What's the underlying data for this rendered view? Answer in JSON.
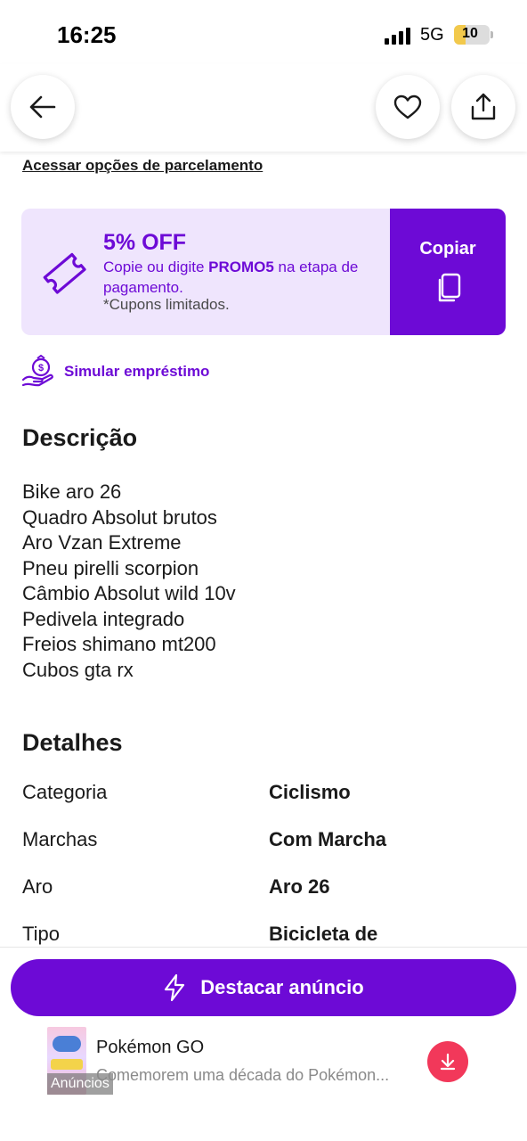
{
  "status_bar": {
    "time": "16:25",
    "network": "5G",
    "battery": "10",
    "battery_level": 0.1
  },
  "nav": {
    "back_icon": "arrow-left-icon",
    "favorite_icon": "heart-icon",
    "share_icon": "share-icon"
  },
  "installment_link": "Acessar opções de parcelamento",
  "coupon": {
    "title": "5% OFF",
    "text_before": "Copie ou digite ",
    "code": "PROMO5",
    "text_after": " na etapa de pagamento.",
    "note": "*Cupons limitados.",
    "copy_label": "Copiar",
    "icon": "ticket-icon",
    "copy_icon": "copy-icon"
  },
  "loan": {
    "label": "Simular empréstimo",
    "icon": "money-bag-hand-icon"
  },
  "description": {
    "title": "Descrição",
    "lines": [
      "Bike aro 26",
      "Quadro Absolut brutos",
      "Aro Vzan Extreme",
      "Pneu pirelli scorpion",
      "Câmbio Absolut wild 10v",
      "Pedivela integrado",
      "Freios shimano mt200",
      "Cubos gta rx"
    ]
  },
  "details": {
    "title": "Detalhes",
    "rows": [
      {
        "key": "Categoria",
        "value": "Ciclismo"
      },
      {
        "key": "Marchas",
        "value": "Com Marcha"
      },
      {
        "key": "Aro",
        "value": "Aro 26"
      },
      {
        "key": "Tipo",
        "value": "Bicicleta de"
      }
    ]
  },
  "cta": {
    "label": "Destacar anúncio",
    "icon": "lightning-icon"
  },
  "ad": {
    "title": "Pokémon GO",
    "subtitle": "Comemorem uma década do Pokémon...",
    "label": "Anúncios",
    "download_icon": "download-icon"
  },
  "colors": {
    "brand_purple": "#6d0ad6",
    "coupon_bg": "#efe5fd",
    "ad_button": "#f2385a"
  }
}
